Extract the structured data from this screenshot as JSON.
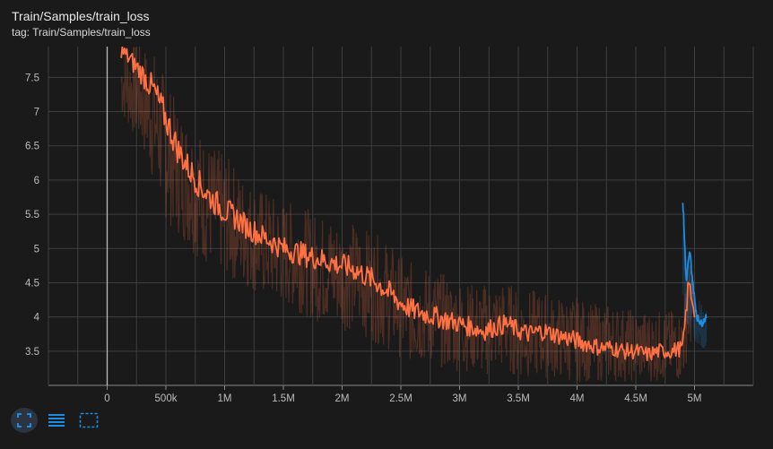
{
  "card": {
    "title": "Train/Samples/train_loss",
    "tag": "tag: Train/Samples/train_loss"
  },
  "toolbar": {
    "buttons": [
      {
        "name": "fit-domain-button",
        "icon": "fullscreen-icon"
      },
      {
        "name": "toggle-log-scale-button",
        "icon": "lines-icon"
      },
      {
        "name": "selection-zoom-button",
        "icon": "dashed-box-icon"
      }
    ],
    "accent": "#1e8ce0"
  },
  "chart_data": {
    "type": "line",
    "title": "Train/Samples/train_loss",
    "xlabel": "",
    "ylabel": "",
    "xlim": [
      -500000,
      5500000
    ],
    "ylim": [
      3.0,
      7.95
    ],
    "x_ticks": [
      0,
      500000,
      1000000,
      1500000,
      2000000,
      2500000,
      3000000,
      3500000,
      4000000,
      4500000,
      5000000
    ],
    "x_tick_labels": [
      "0",
      "500k",
      "1M",
      "1.5M",
      "2M",
      "2.5M",
      "3M",
      "3.5M",
      "4M",
      "4.5M",
      "5M"
    ],
    "y_ticks": [
      3.5,
      4,
      4.5,
      5,
      5.5,
      6,
      6.5,
      7,
      7.5
    ],
    "y_tick_labels": [
      "3.5",
      "4",
      "4.5",
      "5",
      "5.5",
      "6",
      "6.5",
      "7",
      "7.5"
    ],
    "grid": true,
    "legend": "none",
    "series": [
      {
        "color": "#ff7043",
        "x": [
          120000,
          200000,
          300000,
          400000,
          500000,
          600000,
          700000,
          800000,
          900000,
          1000000,
          1100000,
          1200000,
          1300000,
          1400000,
          1500000,
          1600000,
          1700000,
          1800000,
          1900000,
          2000000,
          2100000,
          2200000,
          2300000,
          2400000,
          2500000,
          2600000,
          2700000,
          2800000,
          2900000,
          3000000,
          3100000,
          3200000,
          3300000,
          3400000,
          3500000,
          3600000,
          3700000,
          3800000,
          3900000,
          4000000,
          4100000,
          4200000,
          4300000,
          4400000,
          4500000,
          4600000,
          4700000,
          4800000,
          4900000,
          4950000,
          5000000
        ],
        "y": [
          7.9,
          7.75,
          7.55,
          7.3,
          6.9,
          6.45,
          6.15,
          5.9,
          5.7,
          5.55,
          5.45,
          5.3,
          5.2,
          5.1,
          5.0,
          4.95,
          4.9,
          4.85,
          4.8,
          4.75,
          4.7,
          4.6,
          4.5,
          4.35,
          4.2,
          4.1,
          4.05,
          4.0,
          3.95,
          3.9,
          3.85,
          3.8,
          3.85,
          3.9,
          3.8,
          3.75,
          3.8,
          3.75,
          3.7,
          3.65,
          3.6,
          3.55,
          3.55,
          3.5,
          3.5,
          3.45,
          3.5,
          3.5,
          3.55,
          4.5,
          4.1
        ],
        "raw_min": [
          6.9,
          6.7,
          6.4,
          5.9,
          5.4,
          5.2,
          5.0,
          4.8,
          4.7,
          4.6,
          4.5,
          4.4,
          4.3,
          4.2,
          4.15,
          4.1,
          4.0,
          3.9,
          3.9,
          3.8,
          3.8,
          3.7,
          3.6,
          3.5,
          3.4,
          3.3,
          3.3,
          3.3,
          3.2,
          3.2,
          3.2,
          3.1,
          3.2,
          3.2,
          3.1,
          3.1,
          3.1,
          3.1,
          3.05,
          3.05,
          3.05,
          3.05,
          3.05,
          3.05,
          3.05,
          3.05,
          3.05,
          3.05,
          3.05,
          3.5,
          3.5
        ],
        "raw_max": [
          8.0,
          8.0,
          8.0,
          7.9,
          7.5,
          7.1,
          6.9,
          6.7,
          6.5,
          6.4,
          6.2,
          6.0,
          5.9,
          5.8,
          5.7,
          5.7,
          5.6,
          5.5,
          5.5,
          5.4,
          5.4,
          5.3,
          5.2,
          5.1,
          4.9,
          4.8,
          4.75,
          4.7,
          4.6,
          4.55,
          4.5,
          4.5,
          4.5,
          4.55,
          4.4,
          4.4,
          4.4,
          4.3,
          4.3,
          4.3,
          4.2,
          4.2,
          4.2,
          4.15,
          4.1,
          4.1,
          4.1,
          4.1,
          4.1,
          4.9,
          4.6
        ]
      },
      {
        "color": "#1e8ce0",
        "x": [
          4900000,
          4930000,
          4960000,
          4990000,
          5020000,
          5060000,
          5100000
        ],
        "y": [
          5.72,
          4.5,
          4.95,
          4.4,
          4.0,
          3.9,
          4.0
        ],
        "raw_min": [
          4.0,
          3.8,
          3.8,
          3.7,
          3.6,
          3.5,
          3.55
        ],
        "raw_max": [
          5.72,
          5.0,
          4.95,
          4.5,
          4.3,
          4.2,
          4.1
        ]
      }
    ]
  }
}
